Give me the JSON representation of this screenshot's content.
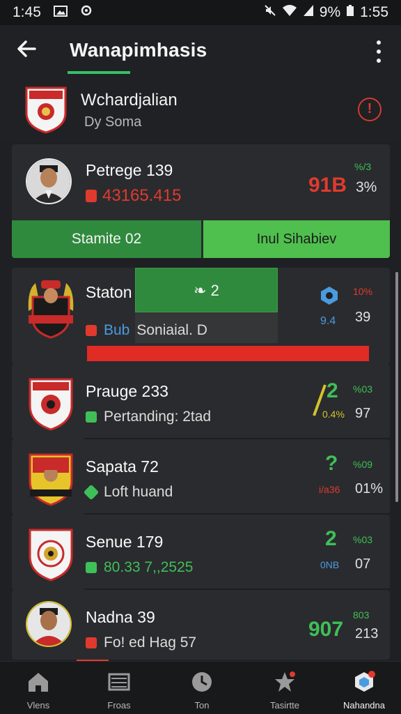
{
  "status_bar": {
    "time_left": "1:45",
    "battery": "9%",
    "time_right": "1:55"
  },
  "app_bar": {
    "title": "Wanapimhasis"
  },
  "league": {
    "name": "Wchardjalian",
    "subtitle": "Dy Soma"
  },
  "featured": {
    "name": "Petrege 139",
    "value": "43165.415",
    "score": "91B",
    "top_right": "%/3",
    "pct": "3%",
    "button_left": "Stamite 02",
    "button_right": "Inul Sihabiev"
  },
  "rows": [
    {
      "name": "Staton",
      "sub": "Soniaial. D",
      "sub_prefix": "Bub",
      "overlay": "❧ 2",
      "right_top": "10%",
      "right_bot": "39",
      "mid_small": "9.4"
    },
    {
      "name": "Prauge 233",
      "sub": "Pertanding: 2tad",
      "big": "2",
      "mid_small": "0.4%",
      "right_top": "%03",
      "right_bot": "97"
    },
    {
      "name": "Sapata 72",
      "sub": "Loft huand",
      "big": "?",
      "mid_small": "i/a36",
      "right_top": "%09",
      "right_bot": "01%"
    },
    {
      "name": "Senue 179",
      "sub": "80.33 7,,2525",
      "big": "2",
      "mid_small": "0NB",
      "right_top": "%03",
      "right_bot": "07"
    },
    {
      "name": "Nadna 39",
      "sub": "Fo! ed Hag 57",
      "big": "907",
      "right_top": "803",
      "right_bot": "213"
    }
  ],
  "bottom_nav": [
    {
      "label": "Vlens",
      "icon": "home-icon"
    },
    {
      "label": "Froas",
      "icon": "gallery-icon"
    },
    {
      "label": "Ton",
      "icon": "clock-icon"
    },
    {
      "label": "Tasirtte",
      "icon": "star-icon"
    },
    {
      "label": "Nahandna",
      "icon": "profile-icon"
    }
  ],
  "colors": {
    "accent_green": "#2f8a3d",
    "accent_red": "#e03a2e",
    "bg": "#1f2023"
  }
}
